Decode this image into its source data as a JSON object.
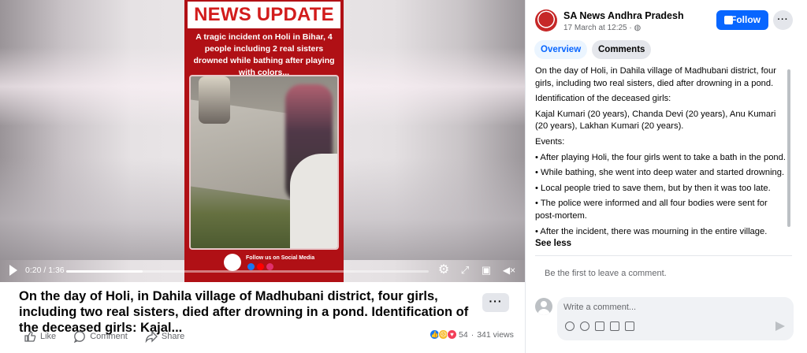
{
  "video": {
    "poster_title": "NEWS UPDATE",
    "poster_subtitle": "A tragic incident on Holi in Bihar, 4 people including 2 real sisters drowned while bathing after playing with colors...",
    "poster_footer": "Follow us on Social Media",
    "time": "0:20 / 1:36",
    "progress": 0.21
  },
  "post": {
    "caption": "On the day of Holi, in Dahila village of Madhubani district, four girls, including two real sisters, died after drowning in a pond. Identification of the deceased girls: Kajal...",
    "actions": {
      "like": "Like",
      "comment": "Comment",
      "share": "Share"
    },
    "reaction_count": "54",
    "views": "341 views"
  },
  "panel": {
    "page_name": "SA News Andhra Pradesh",
    "date": "17 March at 12:25 · ",
    "follow_label": "Follow",
    "tabs": {
      "overview": "Overview",
      "comments": "Comments"
    },
    "body": [
      "On the day of Holi, in Dahila village of Madhubani district, four girls, including two real sisters, died after drowning in a pond.",
      "Identification of the deceased girls:",
      "Kajal Kumari (20 years), Chanda Devi (20 years), Anu Kumari (20 years), Lakhan Kumari (20 years).",
      "Events:",
      "• After playing Holi, the four girls went to take a bath in the pond.",
      "• While bathing, she went into deep water and started drowning.",
      "• Local people tried to save them, but by then it was too late.",
      "• The police were informed and all four bodies were sent for post-mortem.",
      "• After the incident, there was mourning in the entire village."
    ],
    "see_less": "See less",
    "first_comment": "Be the first to leave a comment.",
    "comment_placeholder": "Write a comment..."
  },
  "colors": {
    "accent": "#0866ff",
    "poster_red": "#b01015"
  }
}
